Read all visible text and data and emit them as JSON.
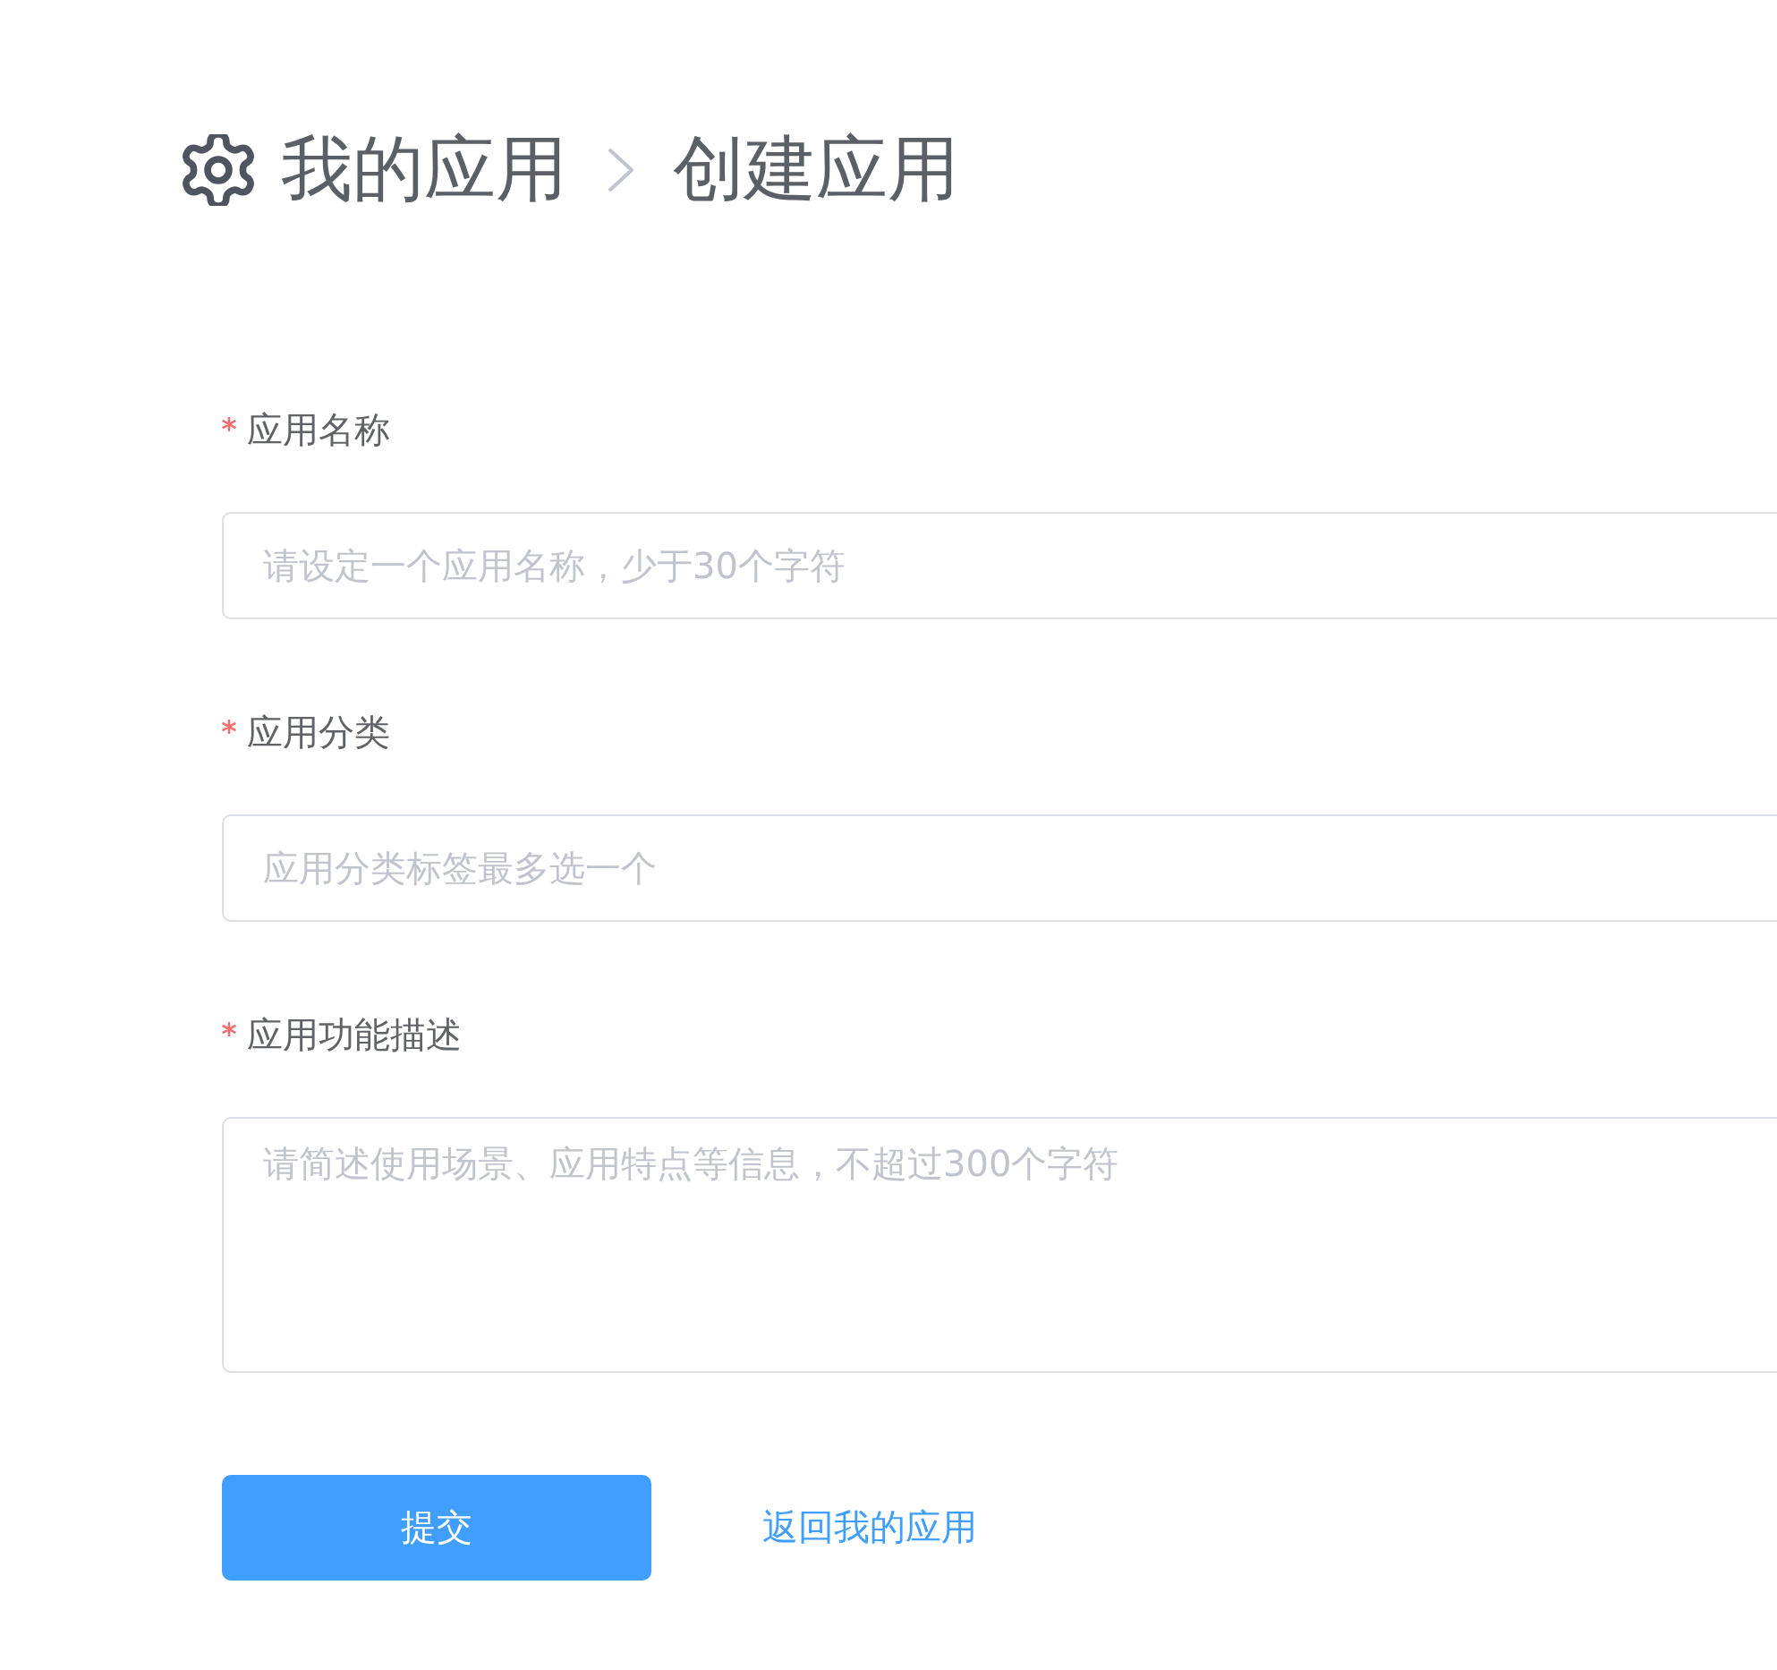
{
  "breadcrumb": {
    "items": [
      {
        "label": "我的应用"
      },
      {
        "label": "创建应用"
      }
    ]
  },
  "fields": [
    {
      "kind": "input",
      "label": "应用名称",
      "required": true,
      "placeholder": "请设定一个应用名称，少于30个字符"
    },
    {
      "kind": "input",
      "label": "应用分类",
      "required": true,
      "placeholder": "应用分类标签最多选一个"
    },
    {
      "kind": "textarea",
      "label": "应用功能描述",
      "required": true,
      "placeholder": "请简述使用场景、应用特点等信息，不超过300个字符"
    }
  ],
  "actions": {
    "submit": "提交",
    "back_link": "返回我的应用"
  }
}
